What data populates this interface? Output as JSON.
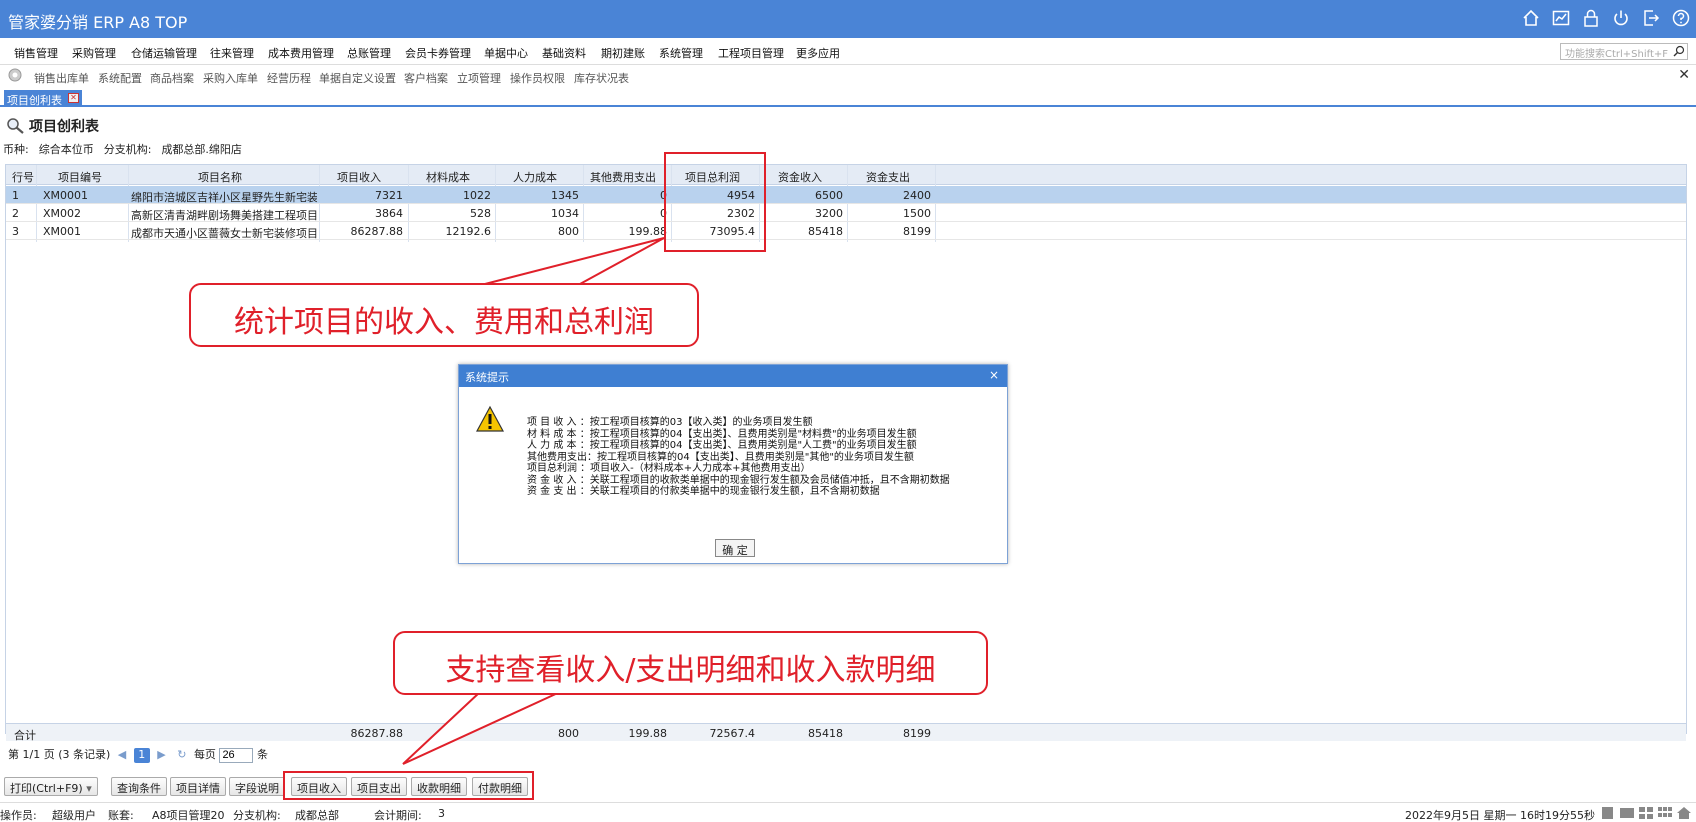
{
  "app": {
    "title": "管家婆分销 ERP A8 TOP"
  },
  "menu": [
    "销售管理",
    "采购管理",
    "仓储运输管理",
    "往来管理",
    "成本费用管理",
    "总账管理",
    "会员卡券管理",
    "单据中心",
    "基础资料",
    "期初建账",
    "系统管理",
    "工程项目管理",
    "更多应用"
  ],
  "search": {
    "placeholder": "功能搜索Ctrl+Shift+F"
  },
  "quicklinks": [
    "销售出库单",
    "系统配置",
    "商品档案",
    "采购入库单",
    "经营历程",
    "单据自定义设置",
    "客户档案",
    "立项管理",
    "操作员权限",
    "库存状况表"
  ],
  "tab": {
    "label": "项目创利表"
  },
  "report": {
    "title": "项目创利表",
    "currency_label": "币种:",
    "currency_value": "综合本位币",
    "branch_label": "分支机构:",
    "branch_value": "成都总部.绵阳店"
  },
  "table": {
    "columns": [
      "行号",
      "项目编号",
      "项目名称",
      "项目收入",
      "材料成本",
      "人力成本",
      "其他费用支出",
      "项目总利润",
      "资金收入",
      "资金支出"
    ],
    "rows": [
      [
        "1",
        "XM0001",
        "绵阳市涪城区吉祥小区星野先生新宅装修项",
        "7321",
        "1022",
        "1345",
        "0",
        "4954",
        "6500",
        "2400"
      ],
      [
        "2",
        "XM002",
        "高新区清青湖畔剧场舞美搭建工程项目",
        "3864",
        "528",
        "1034",
        "0",
        "2302",
        "3200",
        "1500"
      ],
      [
        "3",
        "XM001",
        "成都市天通小区蔷薇女士新宅装修项目",
        "86287.88",
        "12192.6",
        "800",
        "199.88",
        "73095.4",
        "85418",
        "8199"
      ]
    ],
    "totals": [
      "合计",
      "",
      "",
      "86287.88",
      "",
      "800",
      "199.88",
      "72567.4",
      "85418",
      "8199"
    ]
  },
  "pager": {
    "page_text": "第 1/1 页 (3 条记录)",
    "current": "1",
    "per_page_label": "每页",
    "per_page": "26",
    "unit": "条"
  },
  "buttons": {
    "print": "打印(Ctrl+F9)",
    "query": "查询条件",
    "detail": "项目详情",
    "fields": "字段说明",
    "income": "项目收入",
    "expense": "项目支出",
    "receipt": "收款明细",
    "payment": "付款明细"
  },
  "status": {
    "operator_label": "操作员:",
    "operator": "超级用户",
    "account_label": "账套:",
    "account": "A8项目管理20",
    "branch_label": "分支机构:",
    "branch": "成都总部",
    "period_label": "会计期间:",
    "period": "3",
    "datetime": "2022年9月5日 星期一 16时19分55秒"
  },
  "dialog": {
    "title": "系统提示",
    "close": "×",
    "lines": [
      "项 目 收 入 ：按工程项目核算的03【收入类】的业务项目发生额",
      "材 料 成 本 ：按工程项目核算的04【支出类】、且费用类别是\"材料费\"的业务项目发生额",
      "人 力 成 本 ：按工程项目核算的04【支出类】、且费用类别是\"人工费\"的业务项目发生额",
      "其他费用支出：按工程项目核算的04【支出类】、且费用类别是\"其他\"的业务项目发生额",
      "项目总利润  ：项目收入-（材料成本+人力成本+其他费用支出）",
      "资 金 收 入 ：关联工程项目的收款类单据中的现金银行发生额及会员储值冲抵，且不含期初数据",
      "资 金 支 出 ：关联工程项目的付款类单据中的现金银行发生额，且不含期初数据"
    ],
    "ok": "确 定"
  },
  "annotations": {
    "top": "统计项目的收入、费用和总利润",
    "bottom": "支持查看收入/支出明细和收入款明细"
  },
  "colors": {
    "header_blue": "#4a84d6",
    "callout_red": "#e0202a",
    "selected_row": "#b9d2ee"
  }
}
